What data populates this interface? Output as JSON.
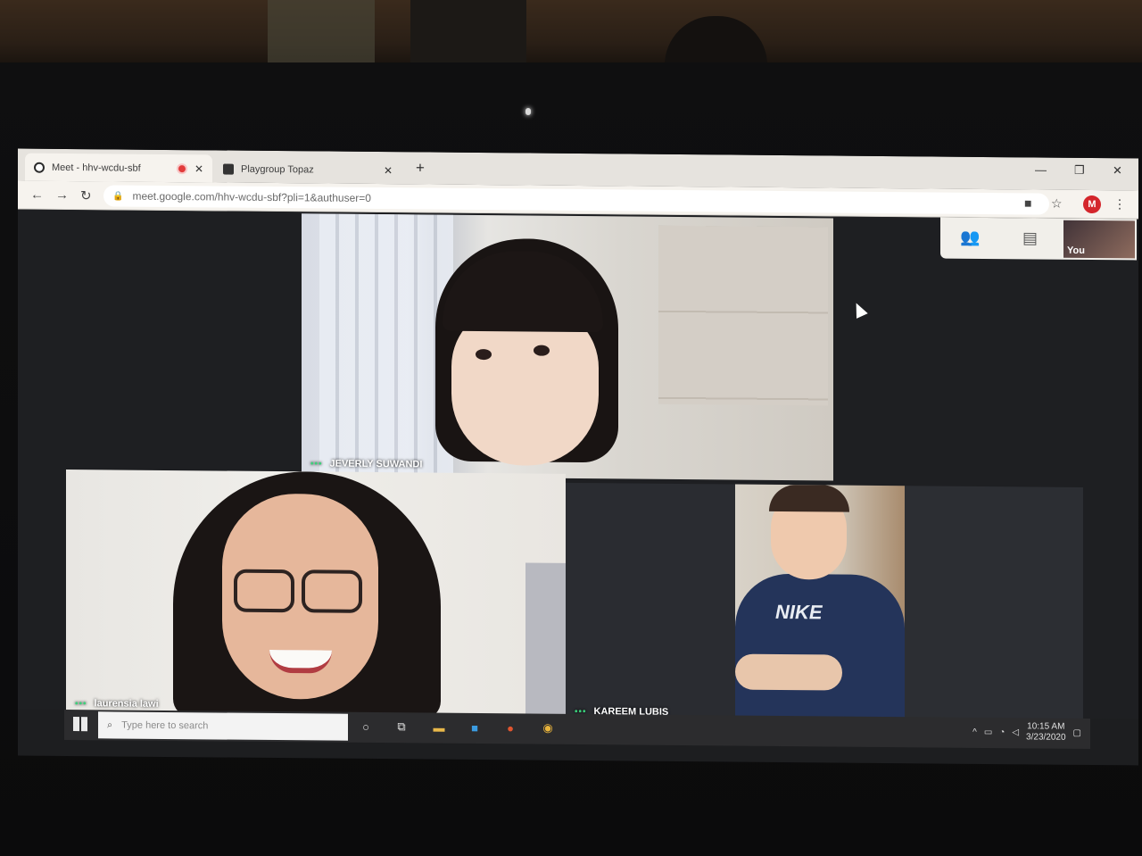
{
  "browser": {
    "tabs": [
      {
        "title": "Meet - hhv-wcdu-sbf",
        "recording": true
      },
      {
        "title": "Playgroup Topaz"
      }
    ],
    "new_tab_symbol": "+",
    "address": "meet.google.com/hhv-wcdu-sbf?pli=1&authuser=0",
    "profile_initial": "M",
    "window_controls": {
      "minimize": "—",
      "restore": "❐",
      "close": "✕"
    }
  },
  "meet": {
    "self_label": "You",
    "participants": [
      {
        "name": "JEVERLY SUWANDI"
      },
      {
        "name": "laurensia lawi"
      },
      {
        "name": "KAREEM LUBIS"
      }
    ],
    "shirt_text": "NIKE"
  },
  "taskbar": {
    "search_placeholder": "Type here to search",
    "time": "10:15 AM",
    "date": "3/23/2020"
  }
}
